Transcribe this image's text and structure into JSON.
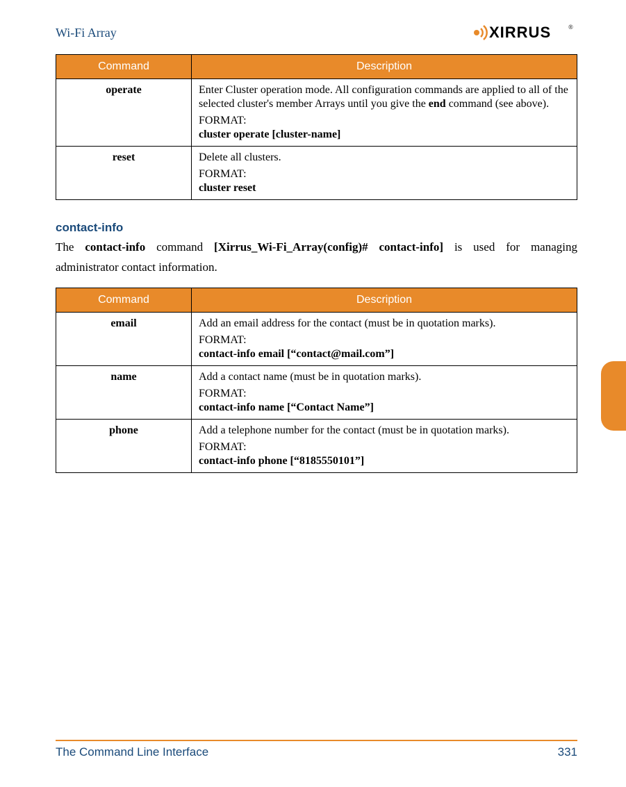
{
  "header": {
    "title": "Wi-Fi Array",
    "logo_text": "XIRRUS"
  },
  "table1": {
    "headers": {
      "command": "Command",
      "description": "Description"
    },
    "rows": [
      {
        "command": "operate",
        "desc_pre": "Enter Cluster operation mode. All configuration commands are applied to all of the selected cluster's member Arrays until you give the ",
        "desc_bold": "end",
        "desc_post": " command (see above).",
        "format_label": "FORMAT:",
        "format_code": "cluster operate [cluster-name]"
      },
      {
        "command": "reset",
        "desc_pre": "Delete all clusters.",
        "desc_bold": "",
        "desc_post": "",
        "format_label": "FORMAT:",
        "format_code": "cluster reset"
      }
    ]
  },
  "section": {
    "heading": "contact-info",
    "text_pre": "The ",
    "text_b1": "contact-info",
    "text_mid1": " command ",
    "text_b2": "[Xirrus_Wi-Fi_Array(config)# contact-info]",
    "text_post": " is used for managing administrator contact information."
  },
  "table2": {
    "headers": {
      "command": "Command",
      "description": "Description"
    },
    "rows": [
      {
        "command": "email",
        "desc": "Add an email address for the contact (must be in quotation marks).",
        "format_label": "FORMAT:",
        "format_code": "contact-info email [“contact@mail.com”]"
      },
      {
        "command": "name",
        "desc": "Add a contact name (must be in quotation marks).",
        "format_label": "FORMAT:",
        "format_code": "contact-info name [“Contact Name”]"
      },
      {
        "command": "phone",
        "desc": "Add a telephone number for the contact (must be in quotation marks).",
        "format_label": "FORMAT:",
        "format_code": "contact-info phone [“8185550101”]"
      }
    ]
  },
  "footer": {
    "left": "The Command Line Interface",
    "right": "331"
  }
}
